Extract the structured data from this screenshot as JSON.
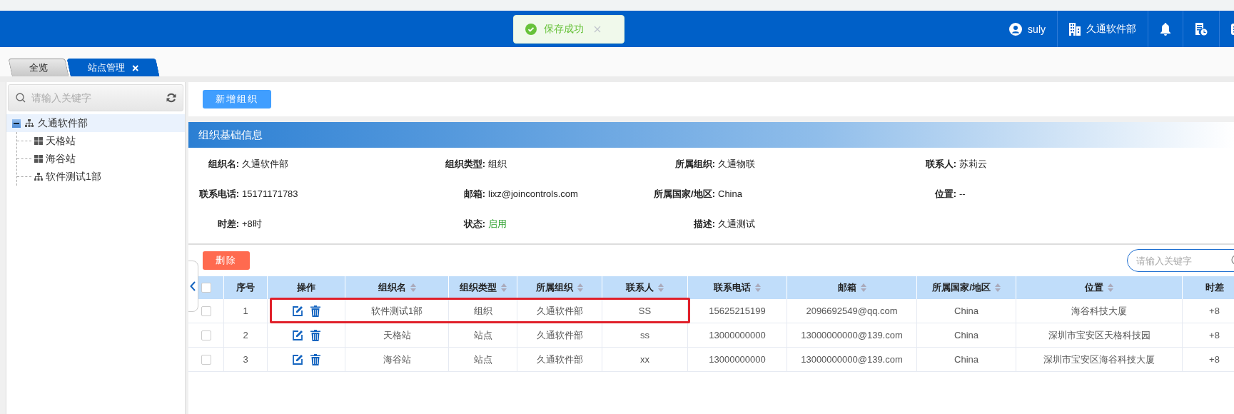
{
  "toast": {
    "text": "保存成功"
  },
  "header": {
    "user": "suly",
    "company": "久通软件部"
  },
  "tabs": [
    {
      "label": "全览",
      "selected": false,
      "closable": false
    },
    {
      "label": "站点管理",
      "selected": true,
      "closable": true
    }
  ],
  "sidebar": {
    "search": {
      "placeholder": "请输入关键字"
    },
    "tree": [
      {
        "label": "久通软件部",
        "kind": "org",
        "expanded": true,
        "selected": true,
        "children": [
          {
            "label": "天格站",
            "kind": "station",
            "selected": false
          },
          {
            "label": "海谷站",
            "kind": "station",
            "selected": false
          },
          {
            "label": "软件测试1部",
            "kind": "org",
            "selected": false
          }
        ]
      }
    ]
  },
  "add_button": "新增组织",
  "info": {
    "title": "组织基础信息",
    "rows": [
      [
        {
          "label": "组织名:",
          "value": "久通软件部",
          "kind": "text"
        },
        {
          "label": "组织类型:",
          "value": "组织",
          "kind": "text"
        },
        {
          "label": "所属组织:",
          "value": "久通物联",
          "kind": "text"
        },
        {
          "label": "联系人:",
          "value": "苏莉云",
          "kind": "text"
        }
      ],
      [
        {
          "label": "联系电话:",
          "value": "15171171783",
          "kind": "text"
        },
        {
          "label": "邮箱:",
          "value": "lixz@joincontrols.com",
          "kind": "text"
        },
        {
          "label": "所属国家/地区:",
          "value": "China",
          "kind": "text"
        },
        {
          "label": "位置:",
          "value": "--",
          "kind": "text"
        }
      ],
      [
        {
          "label": "时差:",
          "value": "+8时",
          "kind": "text"
        },
        {
          "label": "状态:",
          "value": "启用",
          "kind": "status"
        },
        {
          "label": "描述:",
          "value": "久通测试",
          "kind": "text"
        }
      ]
    ]
  },
  "delete_button": "删除",
  "table": {
    "search": {
      "placeholder": "请输入关键字"
    },
    "header_checked": false,
    "columns": [
      {
        "label": "序号",
        "sortable": false
      },
      {
        "label": "操作",
        "sortable": false
      },
      {
        "label": "组织名",
        "sortable": true
      },
      {
        "label": "组织类型",
        "sortable": true
      },
      {
        "label": "所属组织",
        "sortable": true
      },
      {
        "label": "联系人",
        "sortable": true
      },
      {
        "label": "联系电话",
        "sortable": true
      },
      {
        "label": "邮箱",
        "sortable": true
      },
      {
        "label": "所属国家/地区",
        "sortable": true
      },
      {
        "label": "位置",
        "sortable": true
      },
      {
        "label": "时差",
        "sortable": false
      }
    ],
    "rows": [
      {
        "checked": false,
        "annotated": true,
        "cells": [
          "1",
          "",
          "软件测试1部",
          "组织",
          "久通软件部",
          "SS",
          "15625215199",
          "2096692549@qq.com",
          "China",
          "海谷科技大厦",
          "+8"
        ]
      },
      {
        "checked": false,
        "annotated": false,
        "cells": [
          "2",
          "",
          "天格站",
          "站点",
          "久通软件部",
          "ss",
          "13000000000",
          "13000000000@139.com",
          "China",
          "深圳市宝安区天格科技园",
          "+8"
        ]
      },
      {
        "checked": false,
        "annotated": false,
        "cells": [
          "3",
          "",
          "海谷站",
          "站点",
          "久通软件部",
          "xx",
          "13000000000",
          "13000000000@139.com",
          "China",
          "深圳市宝安区海谷科技大厦",
          "+8"
        ]
      }
    ]
  }
}
